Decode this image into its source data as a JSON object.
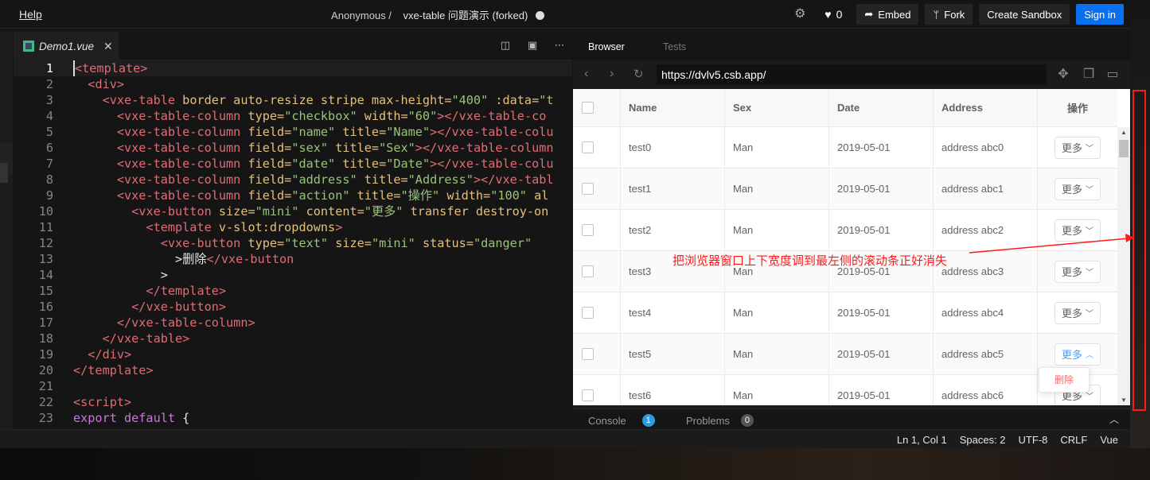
{
  "topbar": {
    "help": "Help",
    "owner": "Anonymous /",
    "project": "vxe-table 问题演示 (forked)",
    "like_count": "0",
    "buttons": {
      "embed": "Embed",
      "fork": "Fork",
      "create": "Create Sandbox",
      "signin": "Sign in"
    }
  },
  "editor": {
    "tab_name": "Demo1.vue",
    "lines": [
      [
        [
          "tg",
          "<template>"
        ]
      ],
      [
        [
          "pl",
          "  "
        ],
        [
          "tg",
          "<div>"
        ]
      ],
      [
        [
          "pl",
          "    "
        ],
        [
          "tg",
          "<vxe-table "
        ],
        [
          "at",
          "border auto-resize stripe max-height="
        ],
        [
          "st",
          "\"400\""
        ],
        [
          "at",
          " :data="
        ],
        [
          "st",
          "\"t"
        ]
      ],
      [
        [
          "pl",
          "      "
        ],
        [
          "tg",
          "<vxe-table-column "
        ],
        [
          "at",
          "type="
        ],
        [
          "st",
          "\"checkbox\""
        ],
        [
          "at",
          " width="
        ],
        [
          "st",
          "\"60\""
        ],
        [
          "tg",
          "></vxe-table-co"
        ]
      ],
      [
        [
          "pl",
          "      "
        ],
        [
          "tg",
          "<vxe-table-column "
        ],
        [
          "at",
          "field="
        ],
        [
          "st",
          "\"name\""
        ],
        [
          "at",
          " title="
        ],
        [
          "st",
          "\"Name\""
        ],
        [
          "tg",
          "></vxe-table-colu"
        ]
      ],
      [
        [
          "pl",
          "      "
        ],
        [
          "tg",
          "<vxe-table-column "
        ],
        [
          "at",
          "field="
        ],
        [
          "st",
          "\"sex\""
        ],
        [
          "at",
          " title="
        ],
        [
          "st",
          "\"Sex\""
        ],
        [
          "tg",
          "></vxe-table-column"
        ]
      ],
      [
        [
          "pl",
          "      "
        ],
        [
          "tg",
          "<vxe-table-column "
        ],
        [
          "at",
          "field="
        ],
        [
          "st",
          "\"date\""
        ],
        [
          "at",
          " title="
        ],
        [
          "st",
          "\"Date\""
        ],
        [
          "tg",
          "></vxe-table-colu"
        ]
      ],
      [
        [
          "pl",
          "      "
        ],
        [
          "tg",
          "<vxe-table-column "
        ],
        [
          "at",
          "field="
        ],
        [
          "st",
          "\"address\""
        ],
        [
          "at",
          " title="
        ],
        [
          "st",
          "\"Address\""
        ],
        [
          "tg",
          "></vxe-tabl"
        ]
      ],
      [
        [
          "pl",
          "      "
        ],
        [
          "tg",
          "<vxe-table-column "
        ],
        [
          "at",
          "field="
        ],
        [
          "st",
          "\"action\""
        ],
        [
          "at",
          " title="
        ],
        [
          "st",
          "\"操作\""
        ],
        [
          "at",
          " width="
        ],
        [
          "st",
          "\"100\""
        ],
        [
          "at",
          " al"
        ]
      ],
      [
        [
          "pl",
          "        "
        ],
        [
          "tg",
          "<vxe-button "
        ],
        [
          "at",
          "size="
        ],
        [
          "st",
          "\"mini\""
        ],
        [
          "at",
          " content="
        ],
        [
          "st",
          "\"更多\""
        ],
        [
          "at",
          " transfer destroy-on"
        ]
      ],
      [
        [
          "pl",
          "          "
        ],
        [
          "tg",
          "<template "
        ],
        [
          "at",
          "v-slot:dropdowns"
        ],
        [
          "tg",
          ">"
        ]
      ],
      [
        [
          "pl",
          "            "
        ],
        [
          "tg",
          "<vxe-button "
        ],
        [
          "at",
          "type="
        ],
        [
          "st",
          "\"text\""
        ],
        [
          "at",
          " size="
        ],
        [
          "st",
          "\"mini\""
        ],
        [
          "at",
          " status="
        ],
        [
          "st",
          "\"danger\""
        ]
      ],
      [
        [
          "pl",
          "              >删除"
        ],
        [
          "tg",
          "</vxe-button"
        ]
      ],
      [
        [
          "pl",
          "            >"
        ]
      ],
      [
        [
          "pl",
          "          "
        ],
        [
          "tg",
          "</template>"
        ]
      ],
      [
        [
          "pl",
          "        "
        ],
        [
          "tg",
          "</vxe-button>"
        ]
      ],
      [
        [
          "pl",
          "      "
        ],
        [
          "tg",
          "</vxe-table-column>"
        ]
      ],
      [
        [
          "pl",
          "    "
        ],
        [
          "tg",
          "</vxe-table>"
        ]
      ],
      [
        [
          "pl",
          "  "
        ],
        [
          "tg",
          "</div>"
        ]
      ],
      [
        [
          "tg",
          "</template>"
        ]
      ],
      [
        [
          "pl",
          ""
        ]
      ],
      [
        [
          "tg",
          "<script>"
        ]
      ],
      [
        [
          "kw",
          "export default"
        ],
        [
          "pl",
          " {"
        ]
      ]
    ]
  },
  "preview": {
    "tabs": {
      "browser": "Browser",
      "tests": "Tests"
    },
    "url": "https://dvlv5.csb.app/",
    "headers": [
      "Name",
      "Sex",
      "Date",
      "Address",
      "操作"
    ],
    "rows": [
      {
        "name": "test0",
        "sex": "Man",
        "date": "2019-05-01",
        "address": "address abc0"
      },
      {
        "name": "test1",
        "sex": "Man",
        "date": "2019-05-01",
        "address": "address abc1"
      },
      {
        "name": "test2",
        "sex": "Man",
        "date": "2019-05-01",
        "address": "address abc2"
      },
      {
        "name": "test3",
        "sex": "Man",
        "date": "2019-05-01",
        "address": "address abc3"
      },
      {
        "name": "test4",
        "sex": "Man",
        "date": "2019-05-01",
        "address": "address abc4"
      },
      {
        "name": "test5",
        "sex": "Man",
        "date": "2019-05-01",
        "address": "address abc5"
      },
      {
        "name": "test6",
        "sex": "Man",
        "date": "2019-05-01",
        "address": "address abc6"
      }
    ],
    "more_label": "更多",
    "active_row_index": 5,
    "dropdown_item": "删除",
    "console": {
      "label": "Console",
      "count": "1"
    },
    "problems": {
      "label": "Problems",
      "count": "0"
    }
  },
  "status_bar": [
    "Ln 1, Col 1",
    "Spaces: 2",
    "UTF-8",
    "CRLF",
    "Vue"
  ],
  "annotation": {
    "text": "把浏览器窗口上下宽度调到最左侧的滚动条正好消失",
    "color": "#ff1a1a"
  }
}
